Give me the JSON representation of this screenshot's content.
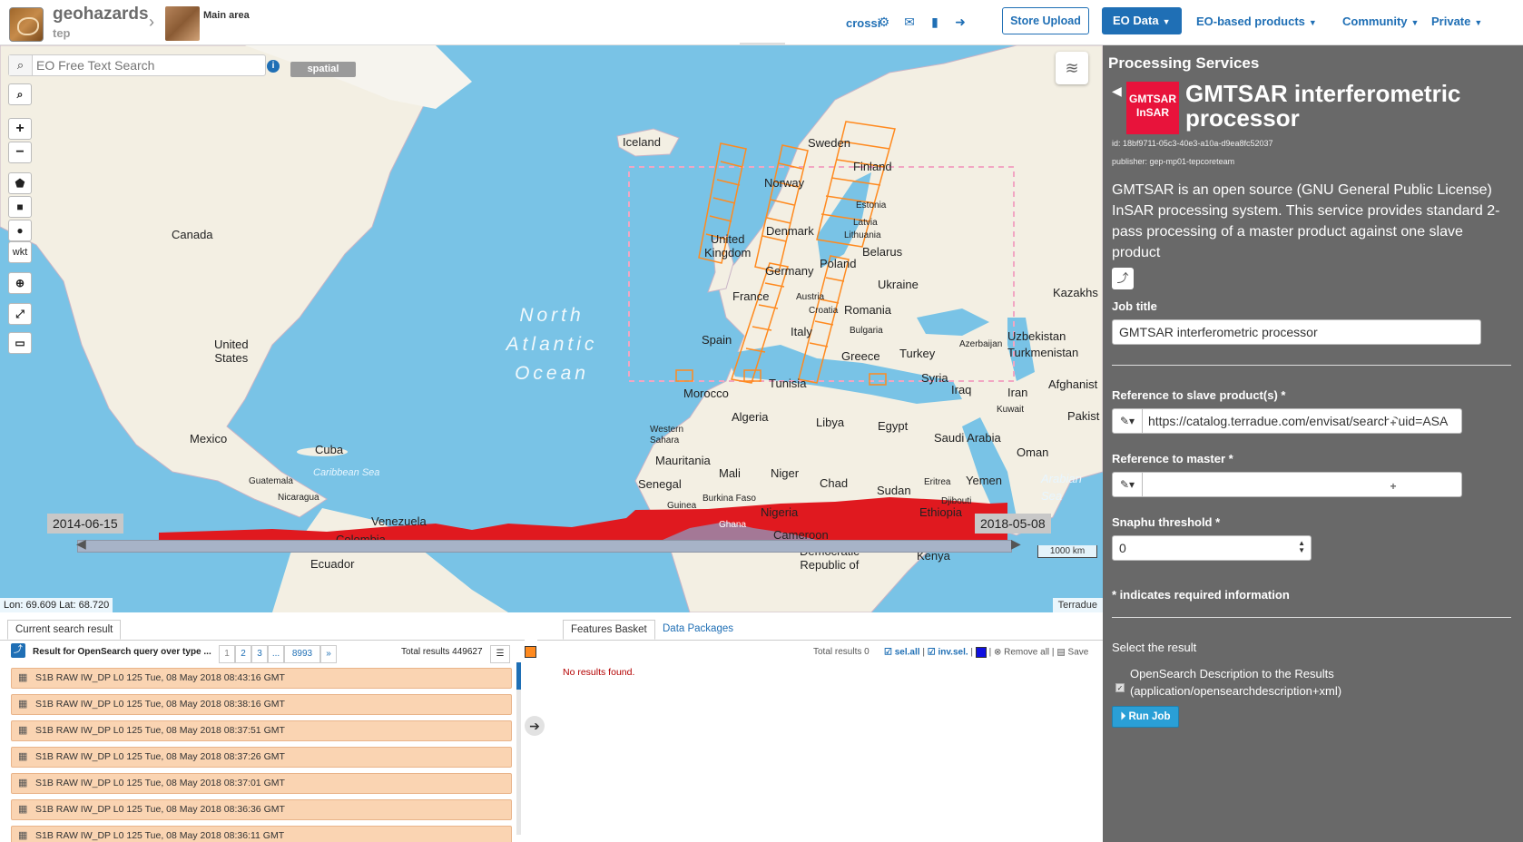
{
  "header": {
    "brand": "geohazards",
    "brand_sub": "tep",
    "separator": "›",
    "area_label": "Main area",
    "user": "crossi",
    "store_upload": "Store Upload",
    "eo_data": "EO Data",
    "nav": [
      "EO-based products",
      "Community",
      "Private"
    ],
    "icons": [
      "gear-icon",
      "envelope-icon",
      "book-icon",
      "sign-out-icon"
    ]
  },
  "map": {
    "search_placeholder": "EO Free Text Search",
    "spatial_button": "spatial",
    "tool_wkt": "wkt",
    "zoom_in": "+",
    "zoom_out": "−",
    "date_start": "2014-06-15",
    "date_end": "2018-05-08",
    "coords": "Lon: 69.609 Lat: 68.720",
    "scale": "1000 km",
    "attribution": "Terradue",
    "ocean_label": "North\nAtlantic\nOcean",
    "labels": {
      "iceland": "Iceland",
      "sweden": "Sweden",
      "finland": "Finland",
      "norway": "Norway",
      "estonia": "Estonia",
      "latvia": "Latvia",
      "lithuania": "Lithuania",
      "denmark": "Denmark",
      "uk": "United\nKingdom",
      "belarus": "Belarus",
      "poland": "Poland",
      "germany": "Germany",
      "ukraine": "Ukraine",
      "kazakhstan": "Kazakhs",
      "france": "France",
      "austria": "Austria",
      "croatia": "Croatia",
      "romania": "Romania",
      "bulgaria": "Bulgaria",
      "italy": "Italy",
      "spain": "Spain",
      "greece": "Greece",
      "turkey": "Turkey",
      "azerbaijan": "Azerbaijan",
      "uzbekistan": "Uzbekistan",
      "turkmenistan": "Turkmenistan",
      "syria": "Syria",
      "iraq": "Iraq",
      "iran": "Iran",
      "afghanistan": "Afghanist",
      "tunisia": "Tunisia",
      "morocco": "Morocco",
      "algeria": "Algeria",
      "libya": "Libya",
      "egypt": "Egypt",
      "kuwait": "Kuwait",
      "pakistan": "Pakist",
      "saudi": "Saudi Arabia",
      "oman": "Oman",
      "western_sahara": "Western\nSahara",
      "mauritania": "Mauritania",
      "mali": "Mali",
      "niger": "Niger",
      "chad": "Chad",
      "sudan": "Sudan",
      "eritrea": "Eritrea",
      "yemen": "Yemen",
      "senegal": "Senegal",
      "burkina": "Burkina Faso",
      "guinea": "Guinea",
      "nigeria": "Nigeria",
      "djibouti": "Djibouti",
      "ghana": "Ghana",
      "ethiopia": "Ethiopia",
      "cameroon": "Cameroon",
      "kenya": "Kenya",
      "drc": "Democratic\nRepublic of",
      "arabian_sea": "Arabian\nSea",
      "canada": "Canada",
      "us": "United\nStates",
      "mexico": "Mexico",
      "cuba": "Cuba",
      "guatemala": "Guatemala",
      "nicaragua": "Nicaragua",
      "caribbean": "Caribbean Sea",
      "venezuela": "Venezuela",
      "colombia": "Colombia",
      "ecuador": "Ecuador"
    },
    "colors": {
      "ocean": "#79c3e6",
      "land": "#f3efe3",
      "tracks": "#ff8a1f",
      "aoi": "#f2a6c3"
    }
  },
  "results": {
    "tab": "Current search result",
    "query": "Result for OpenSearch query over type ...",
    "pages": [
      "1",
      "2",
      "3",
      "...",
      "8993",
      "»"
    ],
    "total_label": "Total results",
    "total_value": "449627",
    "rows": [
      "S1B RAW IW_DP L0 125 Tue, 08 May 2018 08:43:16 GMT",
      "S1B RAW IW_DP L0 125 Tue, 08 May 2018 08:38:16 GMT",
      "S1B RAW IW_DP L0 125 Tue, 08 May 2018 08:37:51 GMT",
      "S1B RAW IW_DP L0 125 Tue, 08 May 2018 08:37:26 GMT",
      "S1B RAW IW_DP L0 125 Tue, 08 May 2018 08:37:01 GMT",
      "S1B RAW IW_DP L0 125 Tue, 08 May 2018 08:36:36 GMT",
      "S1B RAW IW_DP L0 125 Tue, 08 May 2018 08:36:11 GMT"
    ]
  },
  "basket": {
    "tab_features": "Features Basket",
    "tab_packages": "Data Packages",
    "total": "Total results  0",
    "sel_all": "sel.all",
    "inv_sel": "inv.sel.",
    "remove_all": "Remove all",
    "save": "Save",
    "no_results": "No results found."
  },
  "panel": {
    "title": "Processing Services",
    "logo_text": "GMTSAR\nInSAR",
    "service_name": "GMTSAR interferometric processor",
    "id": "id: 18bf9711-05c3-40e3-a10a-d9ea8fc52037",
    "publisher": "publisher: gep-mp01-tepcoreteam",
    "description": "GMTSAR is an open source (GNU General Public License) InSAR processing system. This service provides standard 2-pass processing of a master product against one slave product",
    "job_title_label": "Job title",
    "job_title_value": "GMTSAR interferometric processor",
    "slave_label": "Reference to slave product(s) *",
    "slave_value": "https://catalog.terradue.com/envisat/search?uid=ASA",
    "master_label": "Reference to master *",
    "master_value": "",
    "snaphu_label": "Snaphu threshold *",
    "snaphu_value": "0",
    "required_note": "* indicates required information",
    "select_result": "Select the result",
    "result_option": "OpenSearch Description to the Results (application/opensearchdescription+xml)",
    "run_job": "Run Job"
  }
}
